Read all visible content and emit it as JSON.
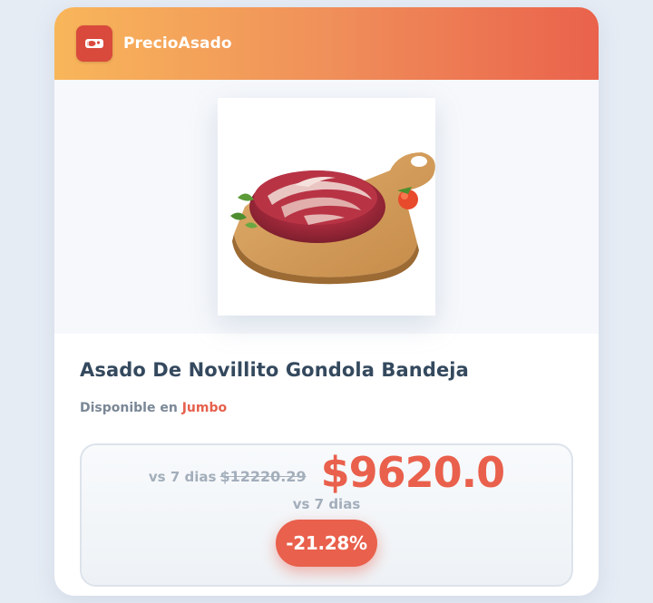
{
  "brand": {
    "name": "PrecioAsado",
    "logo_icon": "meat-icon",
    "colors": {
      "gradient_start": "#f8b65a",
      "gradient_end": "#ea624c",
      "accent": "#e9604c"
    }
  },
  "product": {
    "title": "Asado De Novillito Gondola Bandeja",
    "image_icon": "asado-on-cutting-board-image",
    "availability_label": "Disponible en",
    "store": "Jumbo"
  },
  "pricing": {
    "comparison_label": "vs 7 dias",
    "previous_price": "$12220.29",
    "current_price": "$9620.0",
    "comparison_label_secondary": "vs 7 dias",
    "discount": "-21.28%"
  }
}
